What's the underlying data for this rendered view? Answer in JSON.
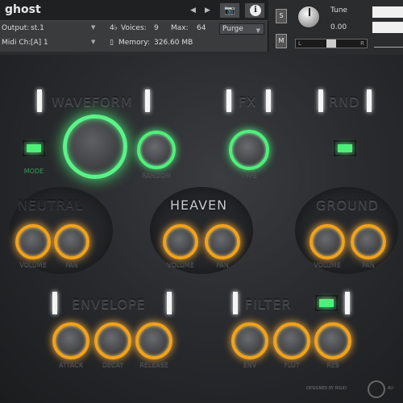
{
  "header": {
    "instrument_name": "ghost",
    "output_label": "Output:",
    "output_value": "st.1",
    "voices_label": "Voices:",
    "voices_value": "9",
    "max_label": "Max:",
    "max_value": "64",
    "purge_label": "Purge",
    "midi_label": "Midi Ch:",
    "midi_value": "[A]  1",
    "memory_label": "Memory:",
    "memory_value": "326.60 MB",
    "solo_label": "S",
    "mute_label": "M",
    "tune_label": "Tune",
    "tune_value": "0.00",
    "pan_left": "L",
    "pan_right": "R",
    "icons": [
      "arrow-left-icon",
      "arrow-right-icon",
      "camera-icon",
      "info-icon",
      "voices-icon",
      "memory-icon"
    ]
  },
  "sections": {
    "waveform": {
      "title": "WAVEFORM",
      "mode_label": "MODE",
      "random_label": "RANDOM"
    },
    "fx": {
      "title": "FX",
      "type_label": "TYPE"
    },
    "rnd": {
      "title": "RND"
    },
    "neutral": {
      "title": "NEUTRAL",
      "volume_label": "VOLUME",
      "pan_label": "PAN"
    },
    "heaven": {
      "title": "HEAVEN",
      "volume_label": "VOLUME",
      "pan_label": "PAN"
    },
    "ground": {
      "title": "GROUND",
      "volume_label": "VOLUME",
      "pan_label": "PAN"
    },
    "envelope": {
      "title": "ENVELOPE",
      "attack_label": "ATTACK",
      "decay_label": "DECAY",
      "release_label": "RELEASE"
    },
    "filter": {
      "title": "FILTER",
      "env_label": "ENV",
      "flut_label": "FLUT",
      "res_label": "RES"
    }
  },
  "footer": {
    "designed_by": "DESIGNED BY",
    "credit": "RIGID",
    "credit_suffix": "AU"
  },
  "colors": {
    "accent_green": "#4ef07a",
    "accent_orange": "#f2a21a",
    "background": "#2a2b2e"
  }
}
